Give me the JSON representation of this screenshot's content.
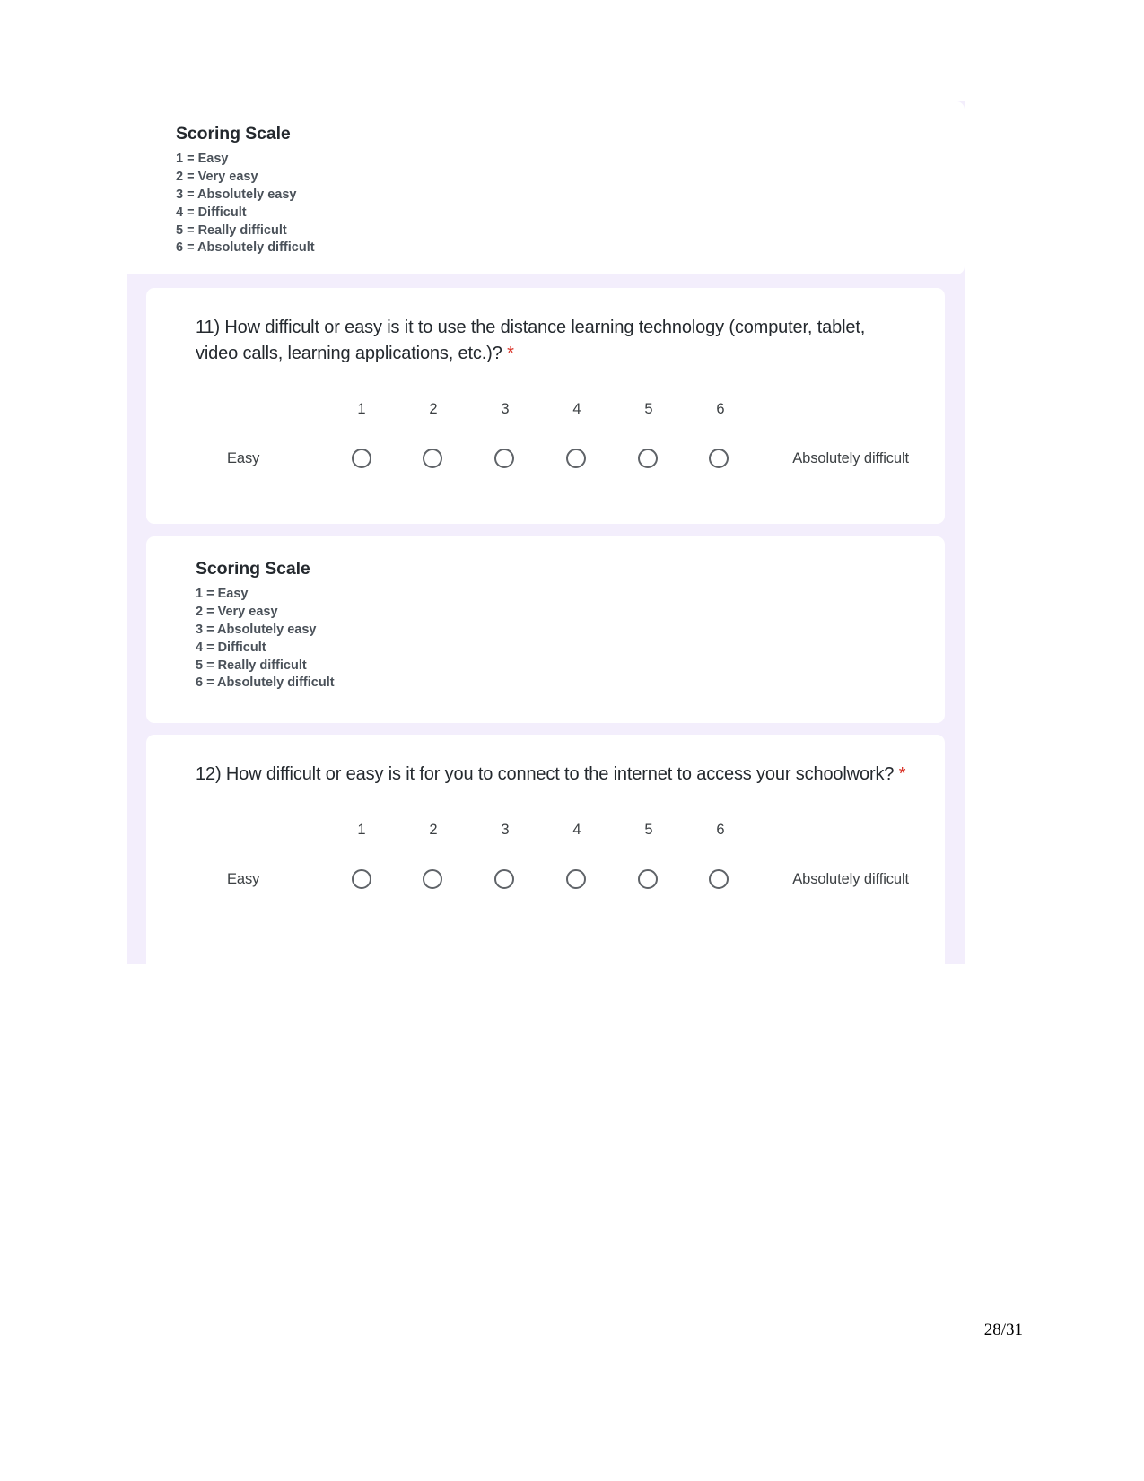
{
  "scoring_scale": {
    "title": "Scoring Scale",
    "items": [
      "1 = Easy",
      "2 = Very easy",
      "3 = Absolutely easy",
      "4 = Difficult",
      "5 = Really difficult",
      "6 = Absolutely difficult"
    ]
  },
  "questions": [
    {
      "text": "11) How difficult or easy is it to use the distance learning technology (computer, tablet, video calls, learning applications, etc.)?",
      "required_marker": "*",
      "scale_numbers": [
        "1",
        "2",
        "3",
        "4",
        "5",
        "6"
      ],
      "left_anchor": "Easy",
      "right_anchor": "Absolutely difficult"
    },
    {
      "text": "12) How difficult or easy is it for you to connect to the internet to access your schoolwork?",
      "required_marker": "*",
      "scale_numbers": [
        "1",
        "2",
        "3",
        "4",
        "5",
        "6"
      ],
      "left_anchor": "Easy",
      "right_anchor": "Absolutely difficult"
    }
  ],
  "footer": {
    "page_number": "28/31"
  },
  "colors": {
    "form_background": "#f3eefc",
    "card_background": "#ffffff",
    "required_asterisk": "#d93025",
    "text_primary": "#24292e",
    "text_secondary": "#4a5159",
    "radio_border": "#5f6368"
  }
}
